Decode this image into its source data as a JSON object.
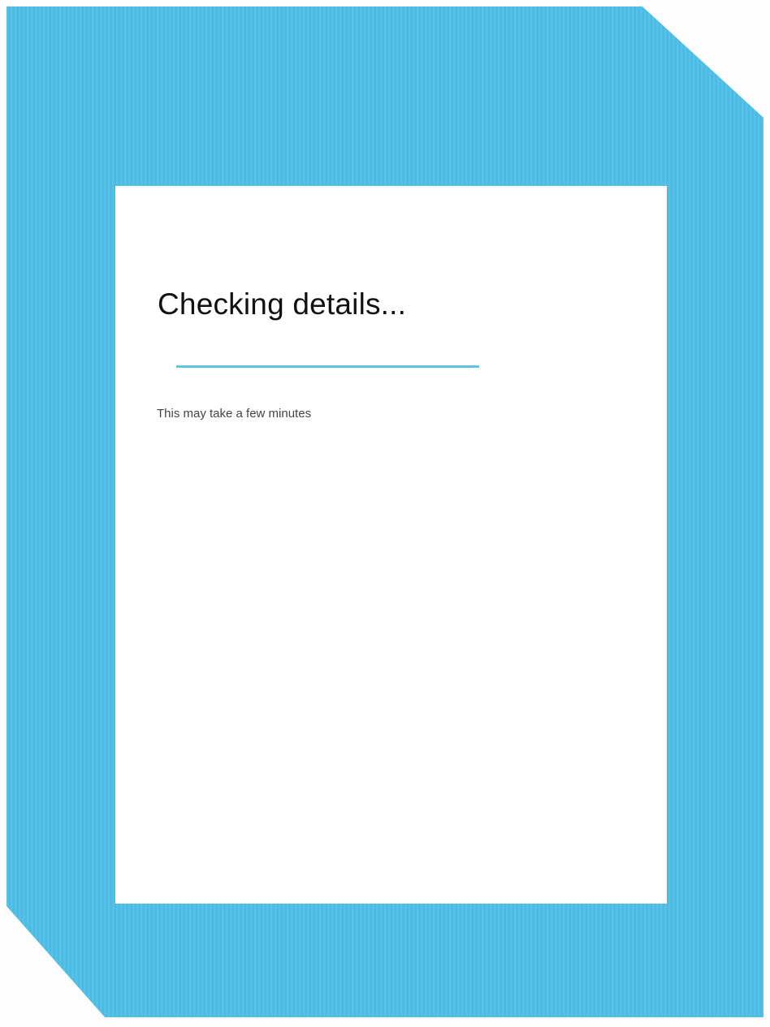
{
  "screen": {
    "title": "Checking details...",
    "subtitle": "This may take a few minutes",
    "progress_indeterminate": true
  },
  "colors": {
    "frame": "#4fc0e8",
    "card": "#ffffff",
    "progress": "#5ec4e6",
    "title_text": "#111111",
    "subtitle_text": "#444444"
  }
}
